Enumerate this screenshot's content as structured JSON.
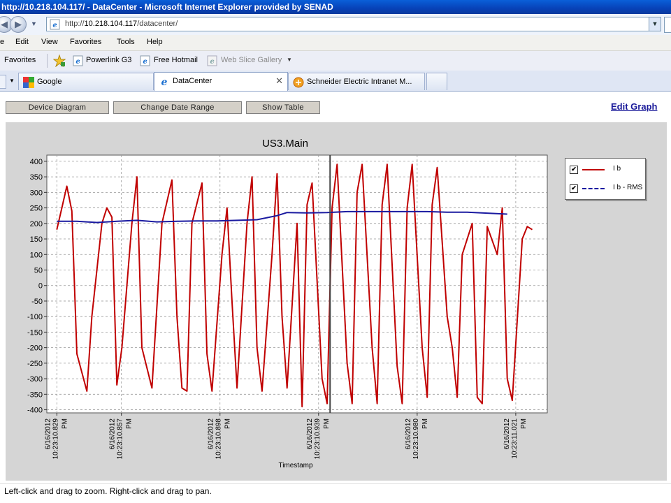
{
  "window": {
    "title": "http://10.218.104.117/ - DataCenter - Microsoft Internet Explorer provided by SENAD"
  },
  "address": {
    "prefix": "http://",
    "host": "10.218.104.117",
    "path": "/datacenter/"
  },
  "menu": [
    "e",
    "Edit",
    "View",
    "Favorites",
    "Tools",
    "Help"
  ],
  "favorites": {
    "label": "Favorites",
    "items": [
      "Powerlink G3",
      "Free Hotmail",
      "Web Slice Gallery"
    ]
  },
  "tabs": [
    {
      "label": "Google"
    },
    {
      "label": "DataCenter"
    },
    {
      "label": "Schneider Electric Intranet M..."
    }
  ],
  "toolbar": {
    "device_diagram": "Device Diagram",
    "change_date_range": "Change Date Range",
    "show_table": "Show Table",
    "edit_graph": "Edit Graph"
  },
  "instructions": "Left-click and drag to zoom. Right-click and drag to pan.",
  "colors": {
    "ib": "#c00000",
    "ib_rms": "#1a1aa0",
    "panel": "#d5d5d5"
  },
  "chart_data": {
    "type": "line",
    "title": "US3.Main",
    "xlabel": "Timestamp",
    "ylabel": "",
    "ylim": [
      -410,
      420
    ],
    "yticks": [
      400,
      350,
      300,
      250,
      200,
      150,
      100,
      50,
      0,
      -50,
      -100,
      -150,
      -200,
      -250,
      -300,
      -350,
      -400
    ],
    "xlim": [
      0,
      100
    ],
    "xticks": [
      {
        "x": 2,
        "date": "6/16/2012",
        "time": "10:23:10.829",
        "ampm": "PM"
      },
      {
        "x": 14.9,
        "date": "6/16/2012",
        "time": "10:23:10.857",
        "ampm": "PM"
      },
      {
        "x": 34.6,
        "date": "6/16/2012",
        "time": "10:23:10.898",
        "ampm": "PM"
      },
      {
        "x": 54.3,
        "date": "6/16/2012",
        "time": "10:23:10.939",
        "ampm": "PM"
      },
      {
        "x": 74.0,
        "date": "6/16/2012",
        "time": "10:23:10.980",
        "ampm": "PM"
      },
      {
        "x": 93.7,
        "date": "6/16/2012",
        "time": "10:23:11.021",
        "ampm": "PM"
      }
    ],
    "cursor_x": 56.6,
    "grid": true,
    "legend_position": "top-right",
    "series": [
      {
        "name": "I b",
        "style": "solid",
        "x": [
          2,
          3,
          4,
          5,
          6,
          8,
          9,
          11,
          12,
          13,
          14,
          15,
          17,
          18,
          19,
          21,
          23,
          25,
          26,
          27,
          28,
          29,
          31,
          32,
          33,
          35,
          36,
          37,
          38,
          40,
          41,
          42,
          43,
          45,
          46,
          47,
          48,
          50,
          51,
          52,
          53,
          55,
          56,
          57,
          58,
          60,
          61,
          62,
          63,
          65,
          66,
          67,
          68,
          70,
          71,
          72,
          73,
          75,
          76,
          77,
          78,
          80,
          81,
          82,
          83,
          85,
          86,
          87,
          88,
          90,
          91,
          92,
          93,
          95,
          96,
          97
        ],
        "y": [
          180,
          250,
          320,
          240,
          -220,
          -340,
          -100,
          200,
          250,
          220,
          -320,
          -200,
          200,
          350,
          -200,
          -330,
          200,
          340,
          -100,
          -330,
          -340,
          200,
          330,
          -220,
          -340,
          100,
          250,
          -50,
          -330,
          200,
          350,
          -200,
          -340,
          100,
          360,
          -100,
          -330,
          200,
          -390,
          260,
          330,
          -300,
          -380,
          250,
          390,
          -250,
          -380,
          300,
          390,
          -200,
          -380,
          260,
          390,
          -260,
          -380,
          250,
          390,
          -200,
          -360,
          260,
          380,
          -100,
          -200,
          -360,
          100,
          200,
          -360,
          -380,
          190,
          100,
          250,
          -300,
          -370,
          150,
          190,
          180
        ],
        "values_note": ""
      },
      {
        "name": "I b - RMS",
        "style": "dashed",
        "x": [
          2,
          6,
          10,
          14,
          18,
          22,
          26,
          30,
          34,
          38,
          42,
          46,
          48,
          52,
          56,
          60,
          64,
          68,
          72,
          76,
          80,
          84,
          88,
          92
        ],
        "y": [
          207,
          207,
          203,
          207,
          210,
          205,
          207,
          208,
          208,
          210,
          212,
          225,
          235,
          234,
          235,
          238,
          238,
          238,
          238,
          238,
          236,
          236,
          233,
          230
        ]
      }
    ]
  }
}
